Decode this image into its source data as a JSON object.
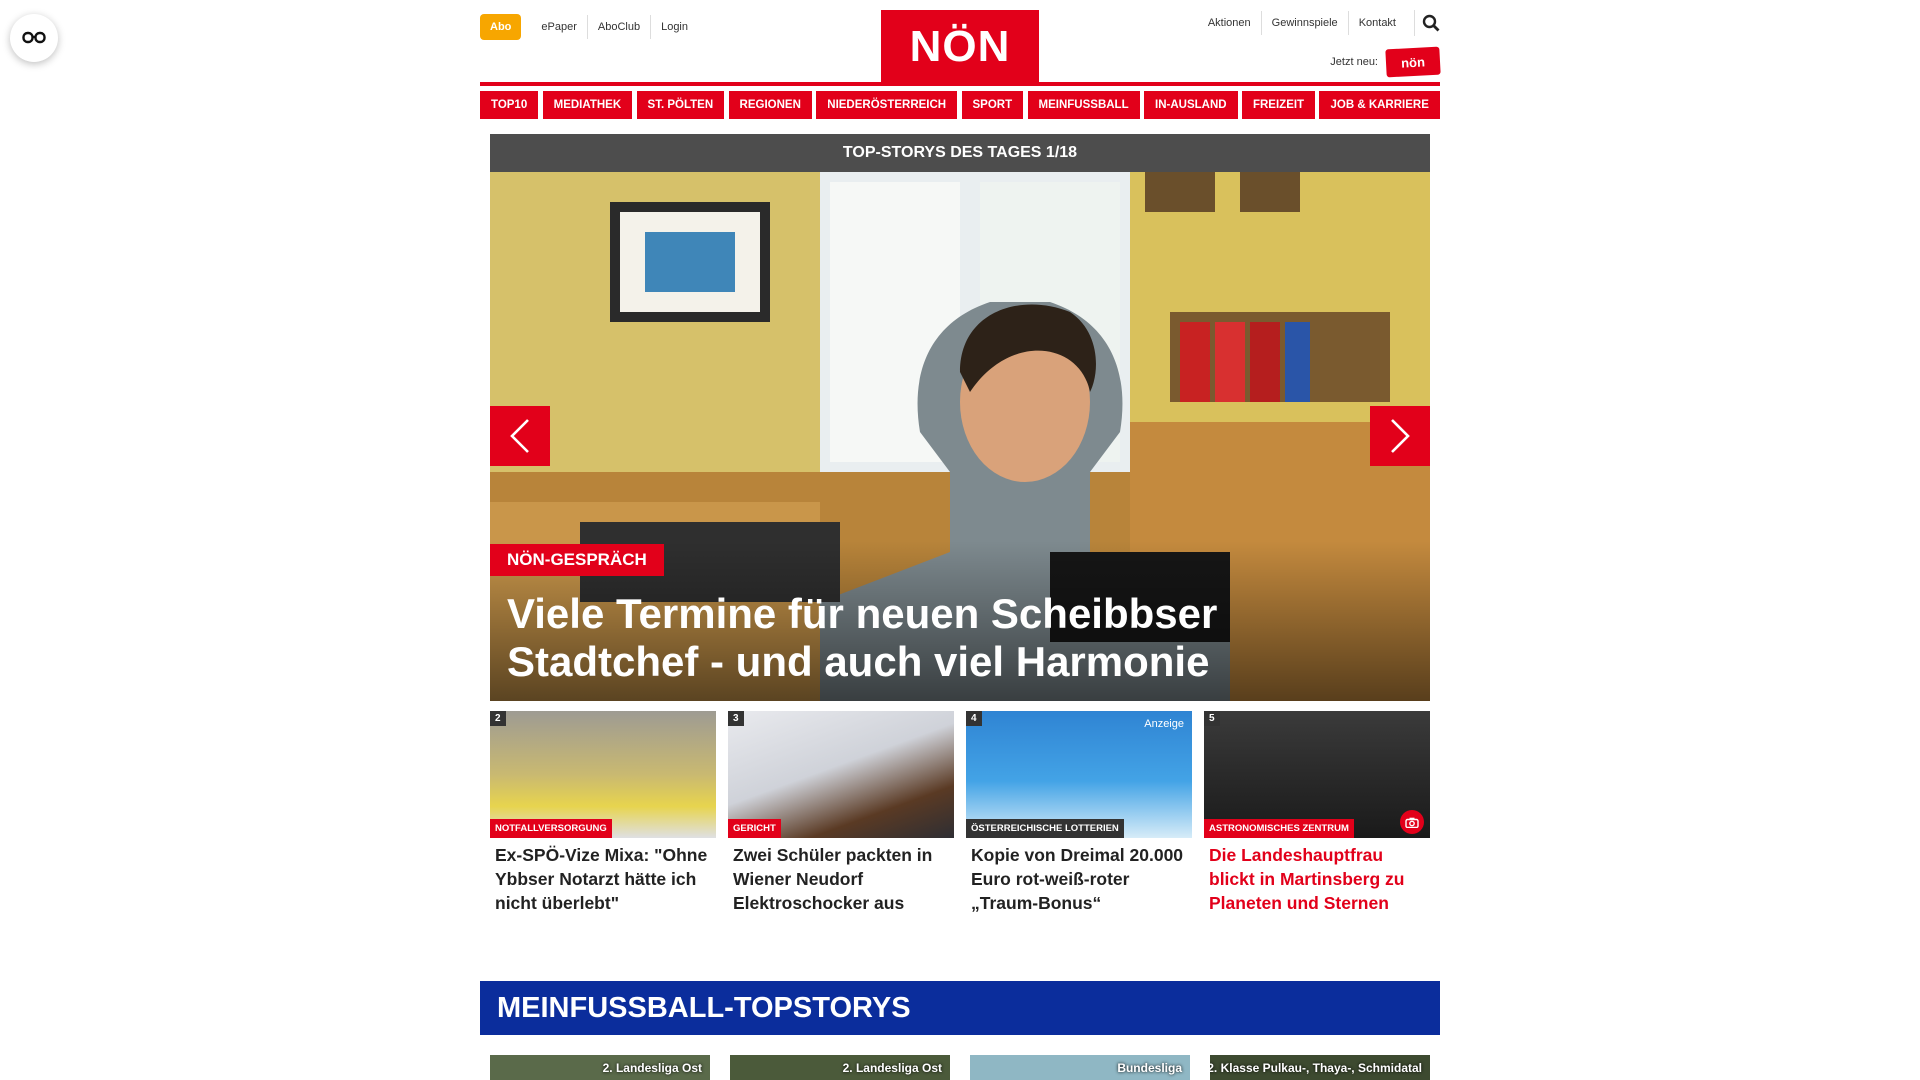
{
  "accessibility": {
    "icon": "eye-glasses-icon"
  },
  "header": {
    "abo_label": "Abo",
    "left_links": [
      "ePaper",
      "AboClub",
      "Login"
    ],
    "logo_text": "NÖN",
    "right_links": [
      "Aktionen",
      "Gewinnspiele",
      "Kontakt"
    ],
    "jetzt_neu": "Jetzt neu:",
    "die_kleine_logo": "die kleine nön"
  },
  "nav": {
    "items": [
      "TOP10",
      "MEDIATHEK",
      "ST. PÖLTEN",
      "REGIONEN",
      "NIEDERÖSTERREICH",
      "SPORT",
      "MEINFUSSBALL",
      "IN-AUSLAND",
      "FREIZEIT",
      "JOB & KARRIERE"
    ]
  },
  "hero": {
    "bar_title": "TOP-STORYS DES TAGES 1/18",
    "kicker": "NÖN-GESPRÄCH",
    "title": "Viele Termine für neuen Scheibbser Stadtchef - und auch viel Harmonie"
  },
  "stories": [
    {
      "num": "2",
      "kicker": "NOTFALLVERSORGUNG",
      "title": "Ex-SPÖ-Vize Mixa: \"Ohne Ybbser Notarzt hätte ich nicht überlebt\"",
      "ad": ""
    },
    {
      "num": "3",
      "kicker": "GERICHT",
      "title": "Zwei Schüler packten in Wiener Neudorf Elektroschocker aus",
      "ad": ""
    },
    {
      "num": "4",
      "kicker": "ÖSTERREICHISCHE LOTTERIEN",
      "title": "Kopie von Dreimal 20.000 Euro rot-weiß-roter „Traum-Bonus“",
      "ad": "Anzeige"
    },
    {
      "num": "5",
      "kicker": "ASTRONOMISCHES ZENTRUM",
      "title": "Die Landeshauptfrau blickt in Martinsberg zu Planeten und Sternen",
      "ad": ""
    }
  ],
  "meinfussball": {
    "title": "MEINFUSSBALL-TOPSTORYS",
    "leagues": [
      "2. Landesliga Ost",
      "2. Landesliga Ost",
      "Bundesliga",
      "2. Klasse Pulkau-, Thaya-, Schmidatal"
    ]
  },
  "colors": {
    "brand_red": "#e2001a",
    "abo_orange": "#f7a600",
    "fussball_blue": "#0b2d9c"
  }
}
